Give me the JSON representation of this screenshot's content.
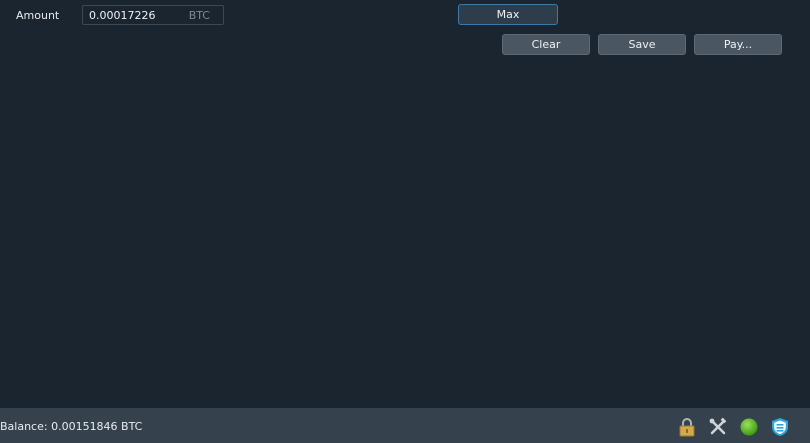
{
  "form": {
    "amount_label": "Amount",
    "amount_value": "0.00017226",
    "amount_unit": "BTC",
    "max_label": "Max"
  },
  "actions": {
    "clear_label": "Clear",
    "save_label": "Save",
    "pay_label": "Pay..."
  },
  "status": {
    "balance": "Balance: 0.00151846 BTC",
    "icons": [
      "lock-icon",
      "preferences-icon",
      "network-status-icon",
      "seed-shield-icon"
    ]
  },
  "colors": {
    "background": "#1b2530",
    "statusbar": "#35424d",
    "button": "#4a5763",
    "max_border": "#3f79a6",
    "network_ok": "#4caf1f"
  }
}
